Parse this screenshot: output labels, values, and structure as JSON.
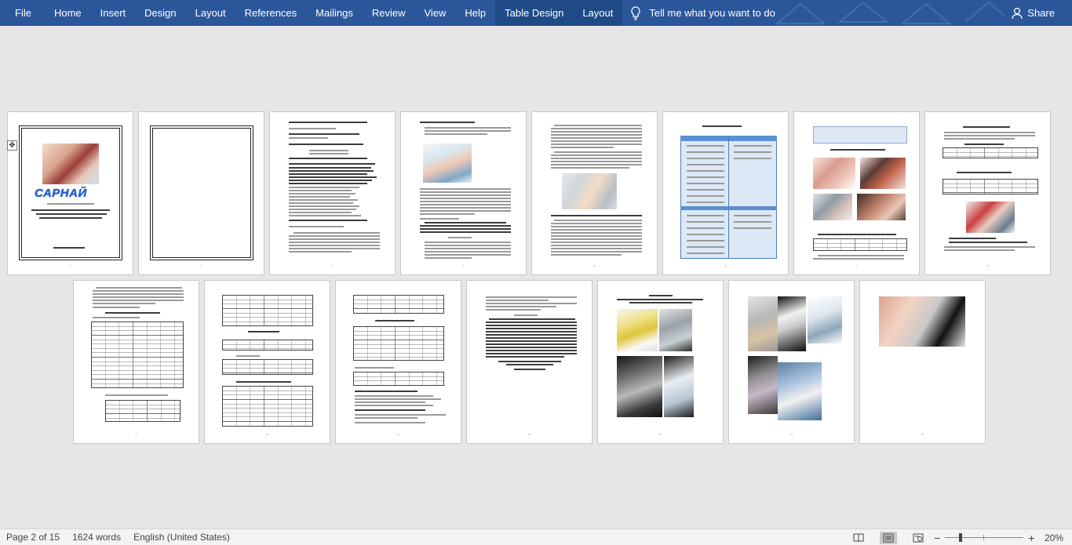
{
  "ribbon": {
    "tabs": [
      {
        "label": "File"
      },
      {
        "label": "Home"
      },
      {
        "label": "Insert"
      },
      {
        "label": "Design"
      },
      {
        "label": "Layout"
      },
      {
        "label": "References"
      },
      {
        "label": "Mailings"
      },
      {
        "label": "Review"
      },
      {
        "label": "View"
      },
      {
        "label": "Help"
      },
      {
        "label": "Table Design"
      },
      {
        "label": "Layout"
      }
    ],
    "tell_me": "Tell me what you want to do",
    "share": "Share",
    "colors": {
      "ribbon": "#2b579a",
      "contextual_tab": "#1f4a86"
    }
  },
  "document": {
    "cover": {
      "title": "САРНАЙ"
    },
    "pages_row1": 8,
    "pages_row2": 7
  },
  "status": {
    "page": "Page 2 of 15",
    "words": "1624 words",
    "language": "English (United States)",
    "zoom": "20%",
    "zoom_level": 0.2
  }
}
